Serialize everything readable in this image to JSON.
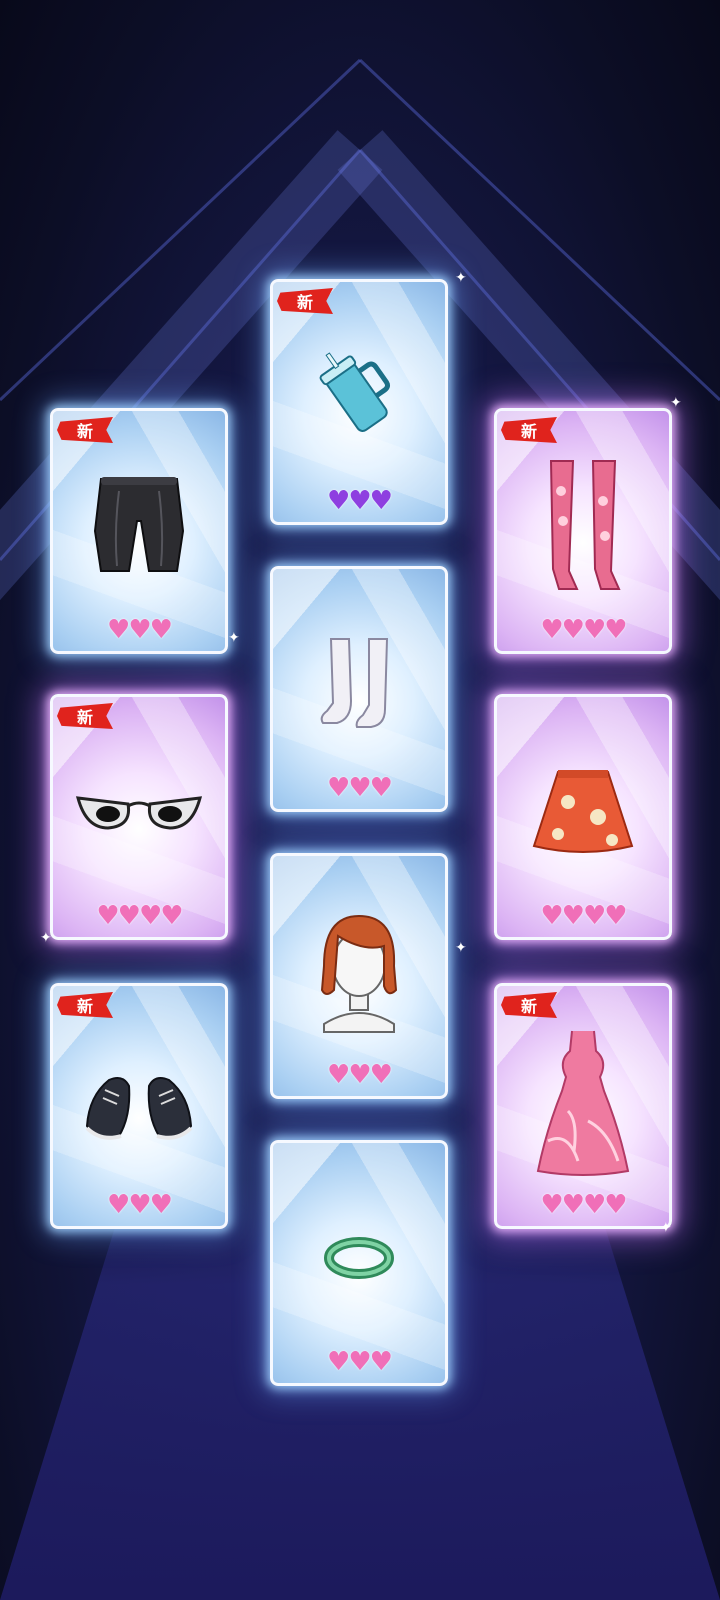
{
  "new_badge_label": "新",
  "cards": [
    {
      "id": "cup",
      "item": "tumbler-cup-icon",
      "new": true,
      "hearts": "♥♥♥",
      "heart_color": "violet",
      "frame": "blue"
    },
    {
      "id": "shorts",
      "item": "biker-shorts-icon",
      "new": true,
      "hearts": "♥♥♥",
      "heart_color": "pink",
      "frame": "blue"
    },
    {
      "id": "stockings",
      "item": "lace-stockings-icon",
      "new": true,
      "hearts": "♥♥♥♥",
      "heart_color": "pink",
      "frame": "purple"
    },
    {
      "id": "socks",
      "item": "white-socks-icon",
      "new": false,
      "hearts": "♥♥♥",
      "heart_color": "pink",
      "frame": "blue"
    },
    {
      "id": "glasses",
      "item": "cat-eye-sunglasses-icon",
      "new": true,
      "hearts": "♥♥♥♥",
      "heart_color": "pink",
      "frame": "purple"
    },
    {
      "id": "skirt",
      "item": "floral-skirt-icon",
      "new": false,
      "hearts": "♥♥♥♥",
      "heart_color": "pink",
      "frame": "purple"
    },
    {
      "id": "hair",
      "item": "bob-hairstyle-icon",
      "new": false,
      "hearts": "♥♥♥",
      "heart_color": "pink",
      "frame": "blue"
    },
    {
      "id": "sneakers",
      "item": "sneakers-icon",
      "new": true,
      "hearts": "♥♥♥",
      "heart_color": "pink",
      "frame": "blue"
    },
    {
      "id": "dress",
      "item": "ruffle-dress-icon",
      "new": true,
      "hearts": "♥♥♥♥",
      "heart_color": "pink",
      "frame": "purple"
    },
    {
      "id": "bracelet",
      "item": "jade-bangle-icon",
      "new": false,
      "hearts": "♥♥♥",
      "heart_color": "pink",
      "frame": "blue"
    }
  ]
}
